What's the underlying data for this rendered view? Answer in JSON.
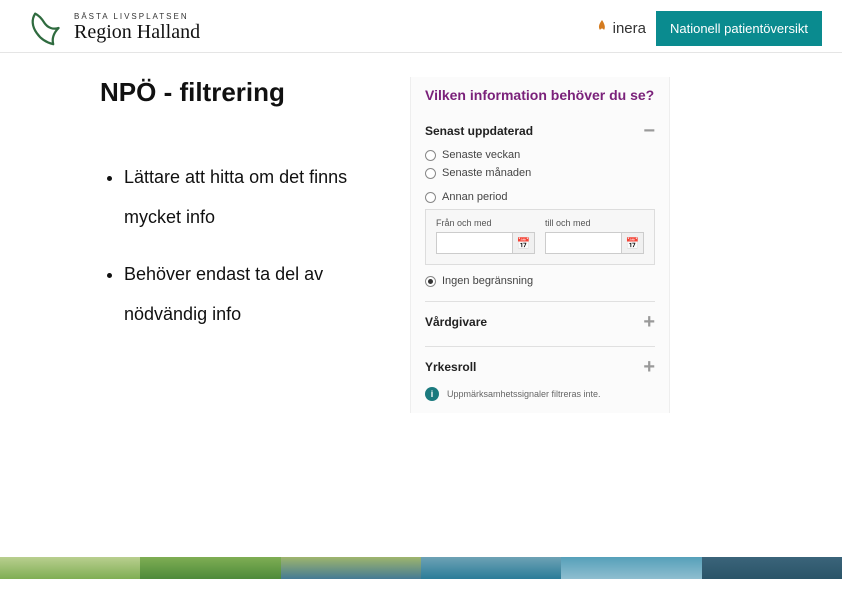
{
  "header": {
    "brand_tagline": "BÄSTA LIVSPLATSEN",
    "brand_name": "Region Halland",
    "inera_label": "inera",
    "npo_badge": "Nationell patientöversikt"
  },
  "slide": {
    "title": "NPÖ - filtrering",
    "bullets": [
      "Lättare att hitta om det finns mycket info",
      "Behöver endast ta del av nödvändig info"
    ]
  },
  "panel": {
    "title": "Vilken information behöver du se?",
    "updated": {
      "header": "Senast uppdaterad",
      "opt_week": "Senaste veckan",
      "opt_month": "Senaste månaden",
      "opt_period": "Annan period",
      "from_label": "Från och med",
      "to_label": "till och med",
      "opt_none": "Ingen begränsning"
    },
    "provider_header": "Vårdgivare",
    "role_header": "Yrkesroll",
    "info_note": "Uppmärksamhetssignaler filtreras inte."
  },
  "footer_colors": [
    "#b9cf8f",
    "#7fae54",
    "#4d8a3a",
    "#9fb56d",
    "#447a94",
    "#6ea2b5",
    "#2a7c98",
    "#56a0b9",
    "#8fbecf",
    "#3b647a"
  ]
}
